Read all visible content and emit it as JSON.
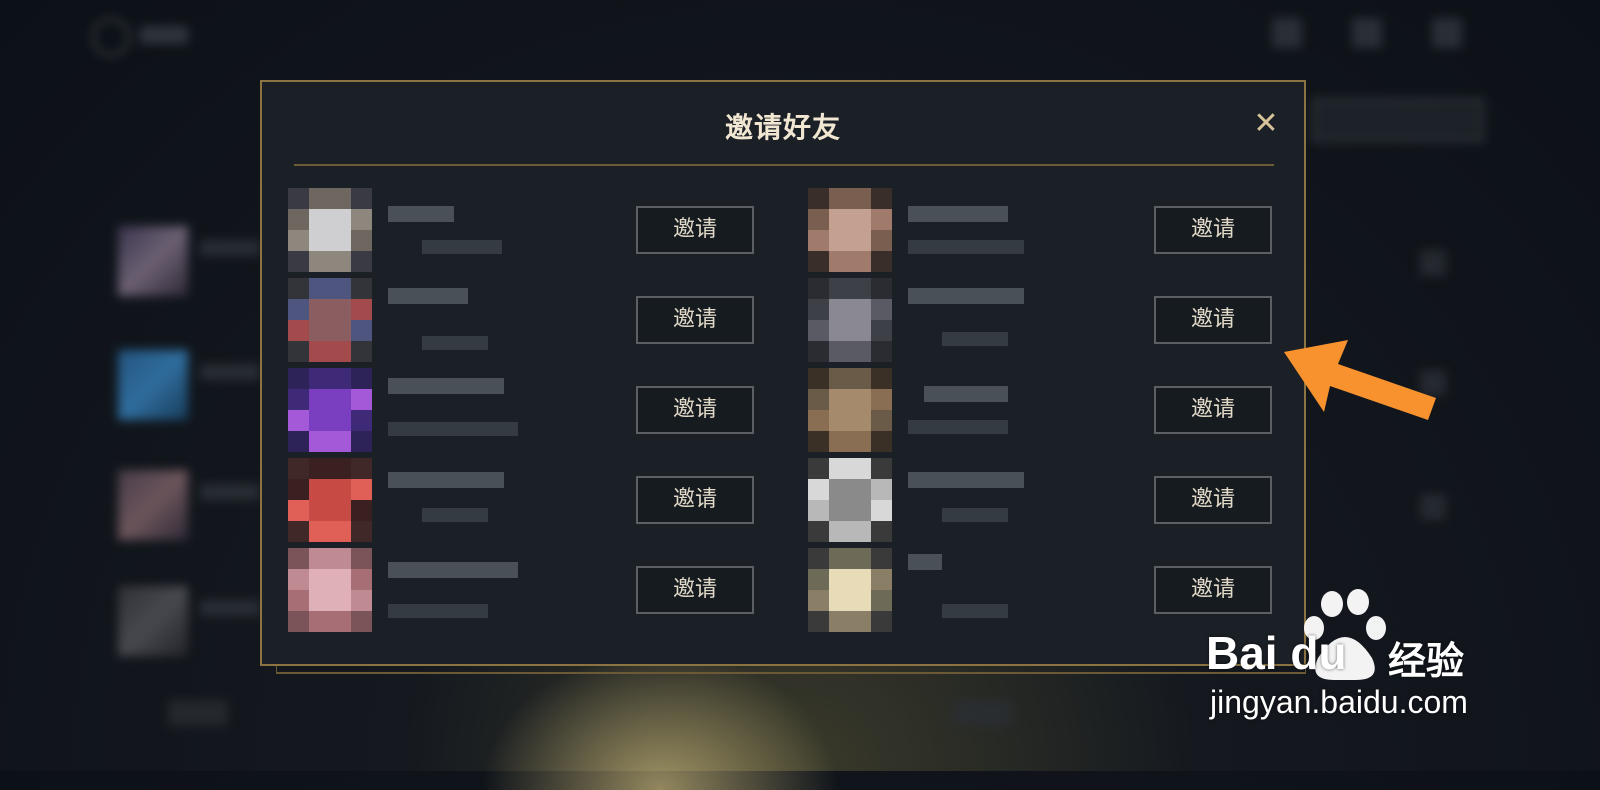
{
  "dialog": {
    "title": "邀请好友",
    "close_icon": "close-icon"
  },
  "friends_left": [
    {
      "invite_label": "邀请",
      "colors": [
        "#6e6760",
        "#cfcfd2",
        "#8d877e",
        "#3a3a44"
      ]
    },
    {
      "invite_label": "邀请",
      "colors": [
        "#4e5680",
        "#8a5e60",
        "#a24a4c",
        "#33343a"
      ]
    },
    {
      "invite_label": "邀请",
      "colors": [
        "#3f2a78",
        "#7a3fc0",
        "#a45ad8",
        "#2d2358"
      ]
    },
    {
      "invite_label": "邀请",
      "colors": [
        "#3a2020",
        "#c84a44",
        "#e06058",
        "#402828"
      ]
    },
    {
      "invite_label": "邀请",
      "colors": [
        "#c08a92",
        "#e0b0b8",
        "#a86e76",
        "#7a5458"
      ]
    }
  ],
  "friends_right": [
    {
      "invite_label": "邀请",
      "colors": [
        "#7a5e50",
        "#c4a090",
        "#a07a6a",
        "#3a2e2a"
      ]
    },
    {
      "invite_label": "邀请",
      "colors": [
        "#3e4048",
        "#8a8890",
        "#5a5a64",
        "#2a2c32"
      ]
    },
    {
      "invite_label": "邀请",
      "colors": [
        "#6a5a48",
        "#a68a6c",
        "#8a6e54",
        "#3a3026"
      ]
    },
    {
      "invite_label": "邀请",
      "colors": [
        "#d8d8d8",
        "#8a8a8a",
        "#b8b8b8",
        "#3a3a3a"
      ]
    },
    {
      "invite_label": "邀请",
      "colors": [
        "#6e6a58",
        "#e8dcb8",
        "#8a7e66",
        "#3a3a3a"
      ]
    }
  ],
  "watermark": {
    "brand": "Bai du",
    "cn": "经验",
    "url": "jingyan.baidu.com"
  },
  "accent_color": "#8c7442",
  "arrow_color": "#f7922e"
}
